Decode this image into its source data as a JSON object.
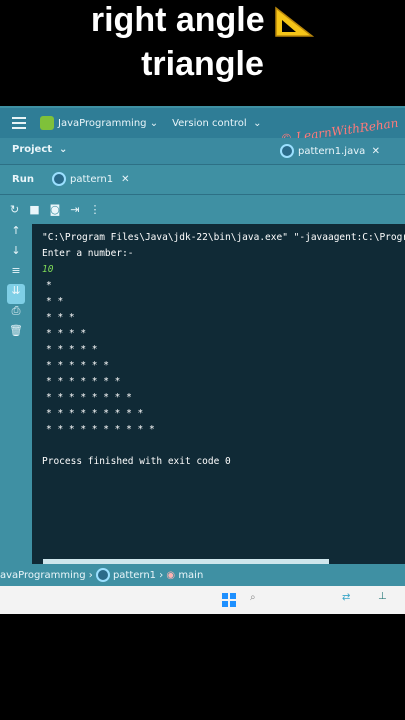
{
  "heading": {
    "line1": "right angle",
    "line2": "triangle",
    "icon": "triangle-ruler-icon"
  },
  "ide": {
    "project_name": "JavaProgramming",
    "version_control": "Version control",
    "watermark": "© LearnWithRehan",
    "project_label": "Project",
    "file_tab": "pattern1.java",
    "run_label": "Run",
    "run_tab": "pattern1",
    "breadcrumb": {
      "project": "avaProgramming",
      "class": "pattern1",
      "method": "main"
    }
  },
  "console": {
    "command": "\"C:\\Program Files\\Java\\jdk-22\\bin\\java.exe\" \"-javaagent:C:\\Progra",
    "prompt": "Enter a number:-",
    "input": "10",
    "rows": [
      "*",
      "* *",
      "* * *",
      "* * * *",
      "* * * * *",
      "* * * * * *",
      "* * * * * * *",
      "* * * * * * * *",
      "* * * * * * * * *",
      "* * * * * * * * * *"
    ],
    "exit": "Process finished with exit code 0"
  },
  "colors": {
    "ide_bg": "#3f90a3",
    "console_bg": "#102a36",
    "input_color": "#7ed957",
    "watermark": "#ff7a7a"
  }
}
